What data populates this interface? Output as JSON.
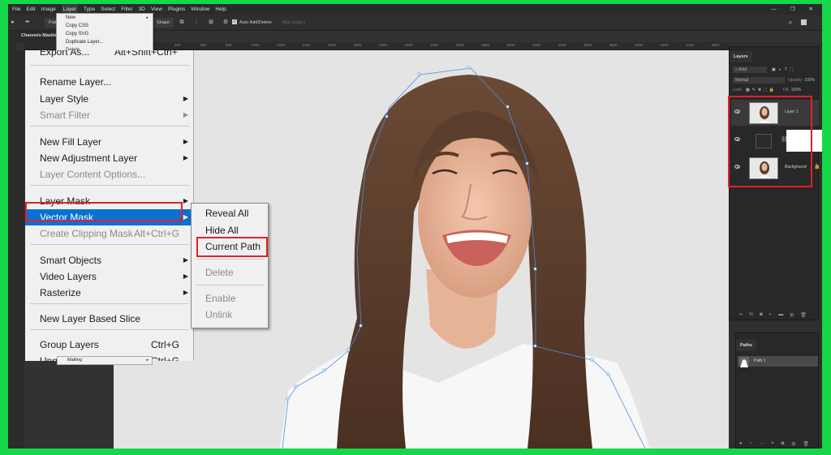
{
  "menubar": {
    "items": [
      "File",
      "Edit",
      "Image",
      "Layer",
      "Type",
      "Select",
      "Filter",
      "3D",
      "View",
      "Plugins",
      "Window",
      "Help"
    ],
    "active": "Layer"
  },
  "window_controls": {
    "minimize": "—",
    "restore": "❐",
    "close": "✕"
  },
  "options_bar": {
    "mode_label": "Path",
    "shape_button": "Shape",
    "auto_add_delete_label": "Auto Add/Delete",
    "auto_add_delete_checked": true,
    "align_edges_label": "Align Edges"
  },
  "document_tab": {
    "title": "Channels Masking"
  },
  "ruler": {
    "ticks": [
      "400",
      "600",
      "800",
      "1000",
      "1200",
      "1400",
      "1600",
      "1800",
      "2000",
      "2200",
      "2400",
      "2600",
      "2800",
      "3000",
      "3200",
      "3400",
      "3600",
      "3800",
      "4000",
      "4200",
      "4400",
      "4600"
    ]
  },
  "layer_menu_top": {
    "items": [
      {
        "label": "New",
        "submenu": true
      },
      {
        "label": "Copy CSS"
      },
      {
        "label": "Copy SVG"
      },
      {
        "label": "Duplicate Layer..."
      },
      {
        "label": "Delete"
      }
    ]
  },
  "layer_menu": {
    "partial_top": {
      "label": "Export As...",
      "shortcut": "Alt+Shift+Ctrl+'"
    },
    "items": [
      {
        "label": "Rename Layer...",
        "disabled": false
      },
      {
        "label": "Layer Style",
        "disabled": false,
        "submenu": true
      },
      {
        "label": "Smart Filter",
        "disabled": true,
        "submenu": true
      },
      {
        "label": "New Fill Layer",
        "disabled": false,
        "submenu": true
      },
      {
        "label": "New Adjustment Layer",
        "disabled": false,
        "submenu": true
      },
      {
        "label": "Layer Content Options...",
        "disabled": true
      },
      {
        "label": "Layer Mask",
        "disabled": false,
        "submenu": true
      },
      {
        "label": "Vector Mask",
        "disabled": false,
        "submenu": true,
        "selected": true
      },
      {
        "label": "Create Clipping Mask",
        "disabled": true,
        "shortcut": "Alt+Ctrl+G"
      },
      {
        "label": "Smart Objects",
        "disabled": false,
        "submenu": true
      },
      {
        "label": "Video Layers",
        "disabled": false,
        "submenu": true
      },
      {
        "label": "Rasterize",
        "disabled": false,
        "submenu": true
      },
      {
        "label": "New Layer Based Slice",
        "disabled": false
      },
      {
        "label": "Group Layers",
        "disabled": false,
        "shortcut": "Ctrl+G"
      },
      {
        "label": "Ungroup Layers",
        "disabled": false,
        "shortcut": "Shift+Ctrl+G"
      }
    ],
    "matting": {
      "label": "Matting",
      "submenu": true
    }
  },
  "vector_mask_submenu": {
    "items": [
      {
        "label": "Reveal All",
        "disabled": false
      },
      {
        "label": "Hide All",
        "disabled": false
      },
      {
        "label": "Current Path",
        "disabled": false,
        "highlighted": true
      },
      {
        "label": "Delete",
        "disabled": true
      },
      {
        "label": "Enable",
        "disabled": true
      },
      {
        "label": "Unlink",
        "disabled": true
      }
    ]
  },
  "layers_panel": {
    "title": "Layers",
    "filter_kind": "Kind",
    "blend_mode": "Normal",
    "opacity_label": "Opacity:",
    "opacity_value": "100%",
    "lock_label": "Lock:",
    "fill_label": "Fill:",
    "fill_value": "100%",
    "layers": [
      {
        "name": "Layer 1",
        "visible": true,
        "type": "image"
      },
      {
        "name": "",
        "visible": true,
        "type": "adjustment-with-mask"
      },
      {
        "name": "Background",
        "visible": true,
        "type": "image",
        "locked": true
      }
    ]
  },
  "paths_panel": {
    "title": "Paths",
    "paths": [
      {
        "name": "Path 1"
      }
    ]
  },
  "colors": {
    "highlight_red": "#e0212a",
    "menu_selection": "#0a71d3",
    "border_green": "#14d84a"
  }
}
